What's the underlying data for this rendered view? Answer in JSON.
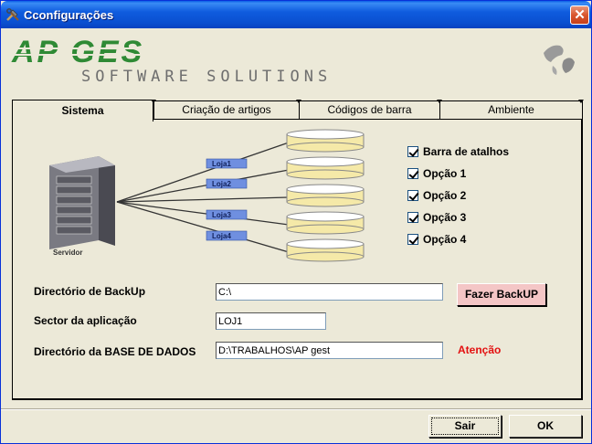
{
  "window": {
    "title": "Cconfigurações",
    "close_glyph": "✕"
  },
  "logo": {
    "name": "AP GES",
    "tagline": "SOFTWARE SOLUTIONS"
  },
  "tabs": [
    {
      "label": "Sistema",
      "active": true
    },
    {
      "label": "Criação de artigos",
      "active": false
    },
    {
      "label": "Códigos de barra",
      "active": false
    },
    {
      "label": "Ambiente",
      "active": false
    }
  ],
  "diagram": {
    "server_label": "Servidor",
    "links": [
      "Loja1",
      "Loja2",
      "Loja3",
      "Loja4"
    ]
  },
  "options": [
    {
      "label": "Barra de atalhos",
      "checked": true
    },
    {
      "label": "Opção 1",
      "checked": true
    },
    {
      "label": "Opção 2",
      "checked": true
    },
    {
      "label": "Opção 3",
      "checked": true
    },
    {
      "label": "Opção 4",
      "checked": true
    }
  ],
  "fields": {
    "backup_label": "Directório de BackUp",
    "backup_value": "C:\\",
    "backup_button": "Fazer BackUP",
    "sector_label": "Sector da aplicação",
    "sector_value": "LOJ1",
    "database_label": "Directório da BASE DE DADOS",
    "database_value": "D:\\TRABALHOS\\AP gest",
    "warning": "Atenção"
  },
  "buttons": {
    "exit": "Sair",
    "ok": "OK"
  },
  "colors": {
    "title_bar": "#0A4FD0",
    "logo_green": "#2F8A35",
    "logo_grey": "#6E6E6E",
    "warning": "#E31010",
    "backup_button": "#F4C6C6",
    "cylinder_fill": "#F5E9A8",
    "link_label": "#6F8FE0"
  }
}
